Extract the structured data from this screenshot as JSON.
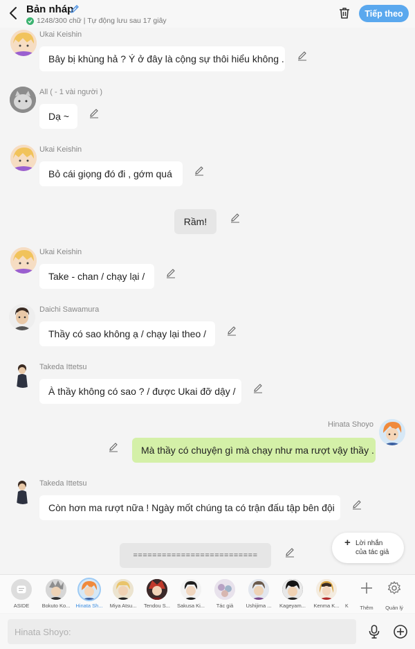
{
  "header": {
    "title": "Bản nháp",
    "subtitle": "1248/300 chữ | Tự động lưu sau 17 giây",
    "next_label": "Tiếp theo"
  },
  "messages": [
    {
      "name": "Ukai Keishin",
      "text": "Bây bị khùng hả ? Ý ở đây là cộng sự thôi hiểu không ."
    },
    {
      "name": "All ( - 1 vài người )",
      "text": "Dạ ~"
    },
    {
      "name": "Ukai Keishin",
      "text": "Bỏ cái giọng đó đi , gớm quá"
    },
    {
      "name": "",
      "text": "Rầm!"
    },
    {
      "name": "Ukai Keishin",
      "text": "Take - chan / chạy lại /"
    },
    {
      "name": "Daichi Sawamura",
      "text": "Thầy có sao không ạ / chạy lại theo /"
    },
    {
      "name": "Takeda Ittetsu",
      "text": "À thầy không có sao ? / được Ukai đỡ dậy /"
    },
    {
      "name": "Hinata Shoyo",
      "text": "Mà thầy có chuyện gì mà chạy như ma rượt vậy thầy ."
    },
    {
      "name": "Takeda Ittetsu",
      "text": "Còn hơn ma rượt nữa ! Ngày mốt chúng ta có trận đấu tập bên đội"
    },
    {
      "name": "",
      "text": "=========================="
    }
  ],
  "author_note": {
    "plus": "+",
    "line1": "Lời nhắn",
    "line2": "của tác giả"
  },
  "characters": [
    {
      "label": "ASIDE"
    },
    {
      "label": "Bokuto Ko..."
    },
    {
      "label": "Hinata Sh..."
    },
    {
      "label": "Miya Atsu..."
    },
    {
      "label": "Tendou S..."
    },
    {
      "label": "Sakusa Ki..."
    },
    {
      "label": "Tác giả"
    },
    {
      "label": "Ushijima ..."
    },
    {
      "label": "Kageyam..."
    },
    {
      "label": "Kenma K..."
    }
  ],
  "more_marker": "K",
  "tools": {
    "add_label": "Thêm",
    "manage_label": "Quản lý"
  },
  "input": {
    "placeholder": "Hinata Shoyo:"
  },
  "colors": {
    "accent": "#5aa8ee",
    "green_bubble": "#d4f0a8",
    "background": "#f4f4f4"
  }
}
